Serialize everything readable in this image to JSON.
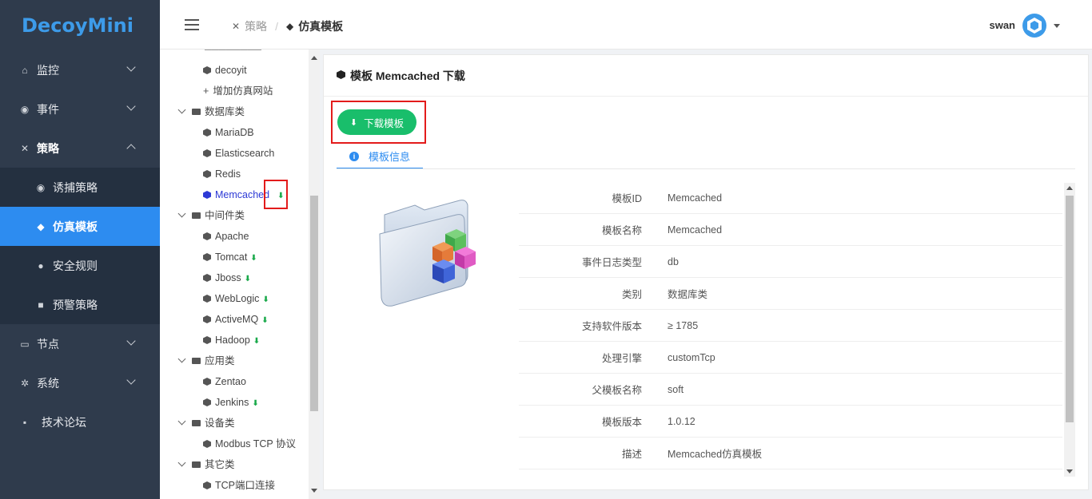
{
  "app": {
    "logo_text": "DecoyMini"
  },
  "sidebar": {
    "items": [
      {
        "label": "监控",
        "icon": "home-icon",
        "expandable": true
      },
      {
        "label": "事件",
        "icon": "target-icon",
        "expandable": true
      },
      {
        "label": "策略",
        "icon": "tools-icon",
        "expandable": true,
        "open": true
      },
      {
        "label": "节点",
        "icon": "monitor-icon",
        "expandable": true
      },
      {
        "label": "系统",
        "icon": "gear-icon",
        "expandable": true
      },
      {
        "label": "技术论坛",
        "icon": "chat-icon",
        "expandable": false
      }
    ],
    "sub_items": [
      {
        "label": "诱捕策略",
        "icon": "eye-icon"
      },
      {
        "label": "仿真模板",
        "icon": "cube-icon",
        "active": true
      },
      {
        "label": "安全规则",
        "icon": "shield-icon"
      },
      {
        "label": "预警策略",
        "icon": "bell-icon"
      }
    ]
  },
  "header": {
    "breadcrumb_root": "策略",
    "breadcrumb_current": "仿真模板",
    "user_name": "swan"
  },
  "tree": {
    "rows": [
      {
        "label": "decoyit",
        "kind": "leaf"
      },
      {
        "label": "增加仿真网站",
        "kind": "add"
      },
      {
        "label": "数据库类",
        "kind": "folder"
      },
      {
        "label": "MariaDB",
        "kind": "leaf"
      },
      {
        "label": "Elasticsearch",
        "kind": "leaf"
      },
      {
        "label": "Redis",
        "kind": "leaf"
      },
      {
        "label": "Memcached",
        "kind": "leaf",
        "selected": true,
        "download": true
      },
      {
        "label": "中间件类",
        "kind": "folder"
      },
      {
        "label": "Apache",
        "kind": "leaf"
      },
      {
        "label": "Tomcat",
        "kind": "leaf",
        "download": true
      },
      {
        "label": "Jboss",
        "kind": "leaf",
        "download": true
      },
      {
        "label": "WebLogic",
        "kind": "leaf",
        "download": true
      },
      {
        "label": "ActiveMQ",
        "kind": "leaf",
        "download": true
      },
      {
        "label": "Hadoop",
        "kind": "leaf",
        "download": true
      },
      {
        "label": "应用类",
        "kind": "folder"
      },
      {
        "label": "Zentao",
        "kind": "leaf"
      },
      {
        "label": "Jenkins",
        "kind": "leaf",
        "download": true
      },
      {
        "label": "设备类",
        "kind": "folder"
      },
      {
        "label": "Modbus TCP 协议",
        "kind": "leaf"
      },
      {
        "label": "其它类",
        "kind": "folder"
      },
      {
        "label": "TCP端口连接",
        "kind": "leaf"
      }
    ]
  },
  "card": {
    "title": "模板 Memcached 下载",
    "download_button": "下载模板",
    "tab_label": "模板信息",
    "rows": [
      {
        "key": "模板ID",
        "value": "Memcached"
      },
      {
        "key": "模板名称",
        "value": "Memcached"
      },
      {
        "key": "事件日志类型",
        "value": "db"
      },
      {
        "key": "类别",
        "value": "数据库类"
      },
      {
        "key": "支持软件版本",
        "value": "≥ 1785"
      },
      {
        "key": "处理引擎",
        "value": "customTcp"
      },
      {
        "key": "父模板名称",
        "value": "soft"
      },
      {
        "key": "模板版本",
        "value": "1.0.12"
      },
      {
        "key": "描述",
        "value": "Memcached仿真模板"
      }
    ]
  },
  "colors": {
    "sidebar_bg": "#2f3b4c",
    "active": "#2d8cf0",
    "download_green": "#19be6b",
    "highlight_red": "#e31b1b"
  }
}
